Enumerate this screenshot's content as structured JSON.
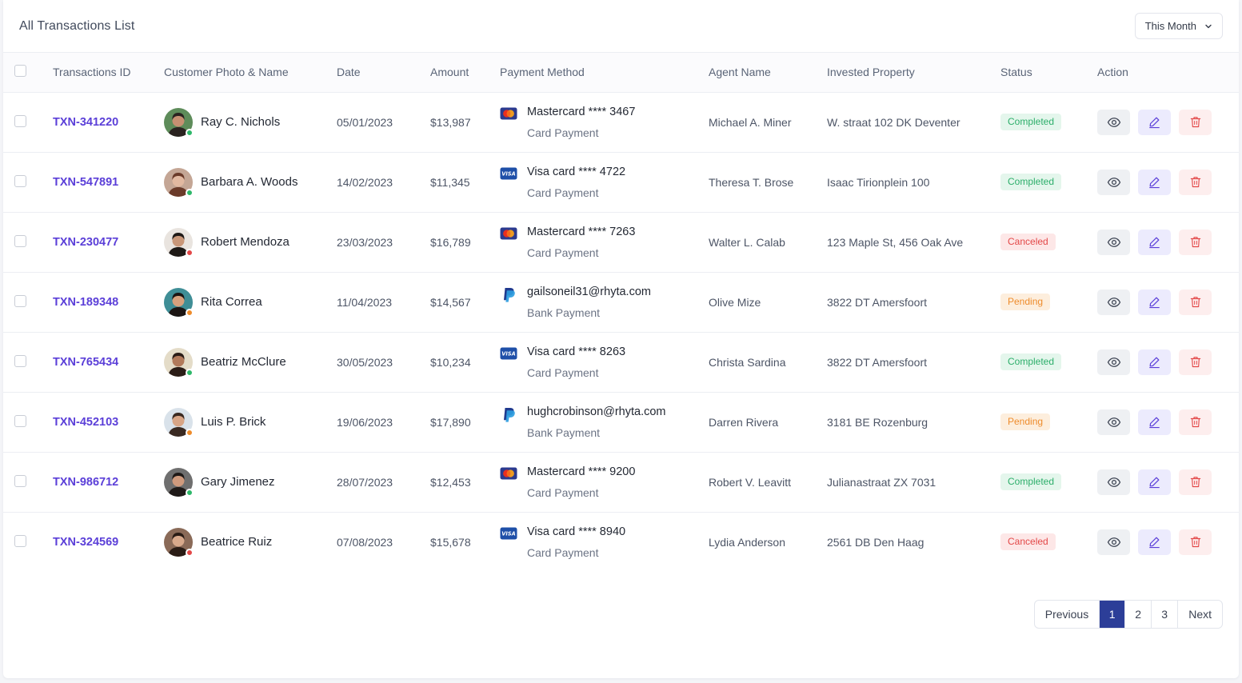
{
  "header": {
    "title": "All Transactions List",
    "period_label": "This Month"
  },
  "columns": [
    "Transactions ID",
    "Customer Photo & Name",
    "Date",
    "Amount",
    "Payment Method",
    "Agent Name",
    "Invested Property",
    "Status",
    "Action"
  ],
  "rows": [
    {
      "id": "TXN-341220",
      "customer": "Ray C. Nichols",
      "date": "05/01/2023",
      "amount": "$13,987",
      "method_type": "mastercard",
      "method": "Mastercard **** 3467",
      "method_sub": "Card Payment",
      "agent": "Michael A. Miner",
      "property": "W. straat 102 DK Deventer",
      "status": "Completed",
      "status_kind": "completed",
      "presence": "#2fb86a",
      "avatar_bg": "#5e8c5a",
      "skin": "#c69072",
      "hair": "#2a2320"
    },
    {
      "id": "TXN-547891",
      "customer": "Barbara A. Woods",
      "date": "14/02/2023",
      "amount": "$11,345",
      "method_type": "visa",
      "method": "Visa card **** 4722",
      "method_sub": "Card Payment",
      "agent": "Theresa T. Brose",
      "property": "Isaac Tirionplein 100",
      "status": "Completed",
      "status_kind": "completed",
      "presence": "#2fb86a",
      "avatar_bg": "#c4a695",
      "skin": "#e2b9a1",
      "hair": "#6b3b2a"
    },
    {
      "id": "TXN-230477",
      "customer": "Robert Mendoza",
      "date": "23/03/2023",
      "amount": "$16,789",
      "method_type": "mastercard",
      "method": "Mastercard **** 7263",
      "method_sub": "Card Payment",
      "agent": "Walter L. Calab",
      "property": "123 Maple St, 456 Oak Ave",
      "status": "Canceled",
      "status_kind": "canceled",
      "presence": "#e34848",
      "avatar_bg": "#e9e4df",
      "skin": "#c99779",
      "hair": "#1f1a17"
    },
    {
      "id": "TXN-189348",
      "customer": "Rita Correa",
      "date": "11/04/2023",
      "amount": "$14,567",
      "method_type": "paypal",
      "method": "gailsoneil31@rhyta.com",
      "method_sub": "Bank Payment",
      "agent": "Olive Mize",
      "property": "3822 DT Amersfoort",
      "status": "Pending",
      "status_kind": "pending",
      "presence": "#ee8c2c",
      "avatar_bg": "#3f8e96",
      "skin": "#d7a17d",
      "hair": "#1c1614"
    },
    {
      "id": "TXN-765434",
      "customer": "Beatriz McClure",
      "date": "30/05/2023",
      "amount": "$10,234",
      "method_type": "visa",
      "method": "Visa card **** 8263",
      "method_sub": "Card Payment",
      "agent": "Christa Sardina",
      "property": "3822 DT Amersfoort",
      "status": "Completed",
      "status_kind": "completed",
      "presence": "#2fb86a",
      "avatar_bg": "#e4dcc8",
      "skin": "#b27a5b",
      "hair": "#2b1d17"
    },
    {
      "id": "TXN-452103",
      "customer": "Luis P. Brick",
      "date": "19/06/2023",
      "amount": "$17,890",
      "method_type": "paypal",
      "method": "hughcrobinson@rhyta.com",
      "method_sub": "Bank Payment",
      "agent": "Darren Rivera",
      "property": "3181 BE Rozenburg",
      "status": "Pending",
      "status_kind": "pending",
      "presence": "#ee8c2c",
      "avatar_bg": "#d9e2ea",
      "skin": "#d8a586",
      "hair": "#3a2a22"
    },
    {
      "id": "TXN-986712",
      "customer": "Gary Jimenez",
      "date": "28/07/2023",
      "amount": "$12,453",
      "method_type": "mastercard",
      "method": "Mastercard **** 9200",
      "method_sub": "Card Payment",
      "agent": "Robert V. Leavitt",
      "property": "Julianastraat ZX 7031",
      "status": "Completed",
      "status_kind": "completed",
      "presence": "#2fb86a",
      "avatar_bg": "#6f6f6f",
      "skin": "#cf9a7d",
      "hair": "#1f1a18"
    },
    {
      "id": "TXN-324569",
      "customer": "Beatrice Ruiz",
      "date": "07/08/2023",
      "amount": "$15,678",
      "method_type": "visa",
      "method": "Visa card **** 8940",
      "method_sub": "Card Payment",
      "agent": "Lydia Anderson",
      "property": "2561 DB Den Haag",
      "status": "Canceled",
      "status_kind": "canceled",
      "presence": "#e34848",
      "avatar_bg": "#8a6a58",
      "skin": "#d8a98c",
      "hair": "#2a1c16"
    }
  ],
  "pagination": {
    "previous": "Previous",
    "pages": [
      "1",
      "2",
      "3"
    ],
    "current": "1",
    "next": "Next"
  },
  "icons": {
    "view": "eye-icon",
    "edit": "pencil-icon",
    "delete": "trash-icon",
    "mastercard": "mastercard-icon",
    "visa": "visa-icon",
    "paypal": "paypal-icon"
  },
  "colors": {
    "accent": "#5b3fd8",
    "pager_active": "#2c3e98",
    "completed": "#2cae6a",
    "canceled": "#e34848",
    "pending": "#ee8c2c"
  }
}
